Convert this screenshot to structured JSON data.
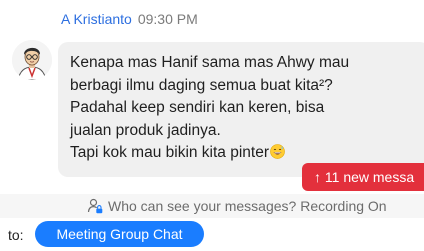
{
  "message": {
    "sender": "A Kristianto",
    "time": "09:30 PM",
    "lines": [
      "Kenapa mas Hanif sama mas Ahwy mau",
      "berbagi ilmu daging semua buat kita²?",
      "Padahal keep sendiri kan keren, bisa",
      "jualan produk jadinya.",
      "Tapi kok mau bikin kita pinter"
    ],
    "emoji": "grinning-sweat-face-emoji"
  },
  "new_messages": {
    "label": "↑ 11 new messa"
  },
  "privacy": {
    "icon": "person-lock-icon",
    "text": "Who can see your messages? Recording On"
  },
  "composer": {
    "to_label": "to:",
    "recipient": "Meeting Group Chat"
  },
  "colors": {
    "sender": "#2d6fe0",
    "new_messages_bg": "#e3303c",
    "recipient_bg": "#1a7dff",
    "bubble_bg": "#f0f0f0"
  }
}
